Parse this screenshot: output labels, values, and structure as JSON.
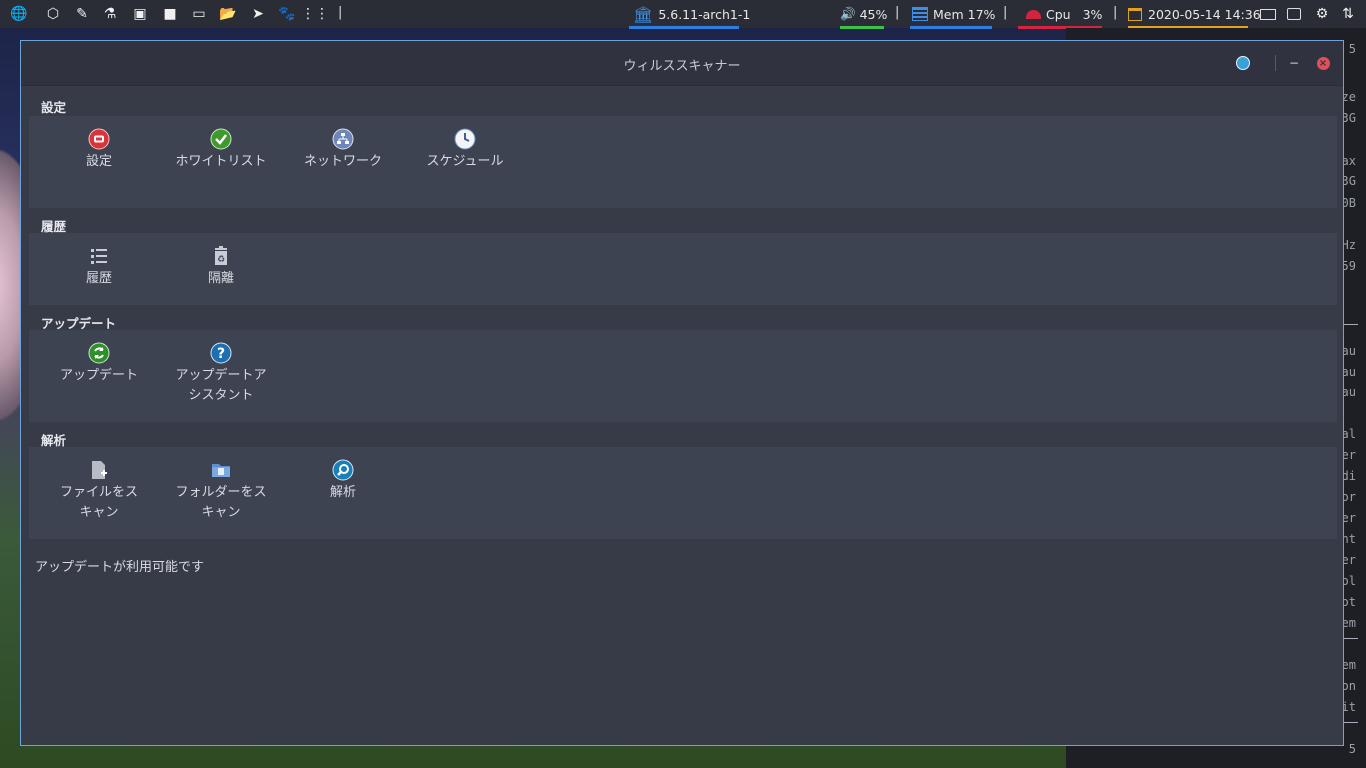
{
  "panel": {
    "kernel": "5.6.11-arch1-1",
    "volume": "45%",
    "mem": "Mem 17%",
    "cpu_label": "Cpu",
    "cpu_value": "3%",
    "datetime": "2020-05-14 14:36",
    "separator": "|",
    "launchers": [
      "globe-icon",
      "codepen-icon",
      "eyedropper-icon",
      "flask-icon",
      "image-icon",
      "video-icon",
      "laptop-icon",
      "folder-icon",
      "telegram-icon",
      "paw-icon",
      "apps-grid-icon"
    ],
    "underline_colors": {
      "kernel": "#2f7de0",
      "volume": "#3cc24a",
      "mem": "#2f7de0",
      "cpu": "#d4233e",
      "date": "#e0a020"
    }
  },
  "terminal_fragments": [
    "5",
    "ze",
    "3G",
    "ax",
    "3G",
    "0B",
    "Hz",
    "59",
    "au",
    "au",
    "au",
    "al",
    "er",
    "di",
    "or",
    "er",
    "nt",
    "er",
    "ol",
    "ot",
    "em",
    "em",
    "on",
    "it",
    "5"
  ],
  "window": {
    "title": "ウィルススキャナー",
    "sections": [
      {
        "title": "設定",
        "items": [
          {
            "label": "設定",
            "icon": "settings-red-icon"
          },
          {
            "label": "ホワイトリスト",
            "icon": "whitelist-check-icon"
          },
          {
            "label": "ネットワーク",
            "icon": "network-icon"
          },
          {
            "label": "スケジュール",
            "icon": "clock-icon"
          }
        ]
      },
      {
        "title": "履歴",
        "items": [
          {
            "label": "履歴",
            "icon": "list-icon"
          },
          {
            "label": "隔離",
            "icon": "trash-recycle-icon"
          }
        ]
      },
      {
        "title": "アップデート",
        "items": [
          {
            "label": "アップデート",
            "icon": "update-refresh-icon"
          },
          {
            "label": "アップデートア\nシスタント",
            "icon": "help-question-icon"
          }
        ]
      },
      {
        "title": "解析",
        "items": [
          {
            "label": "ファイルをス\nキャン",
            "icon": "file-add-icon"
          },
          {
            "label": "フォルダーをス\nキャン",
            "icon": "folder-doc-icon"
          },
          {
            "label": "解析",
            "icon": "magnifier-icon"
          }
        ]
      }
    ],
    "status": "アップデートが利用可能です"
  }
}
